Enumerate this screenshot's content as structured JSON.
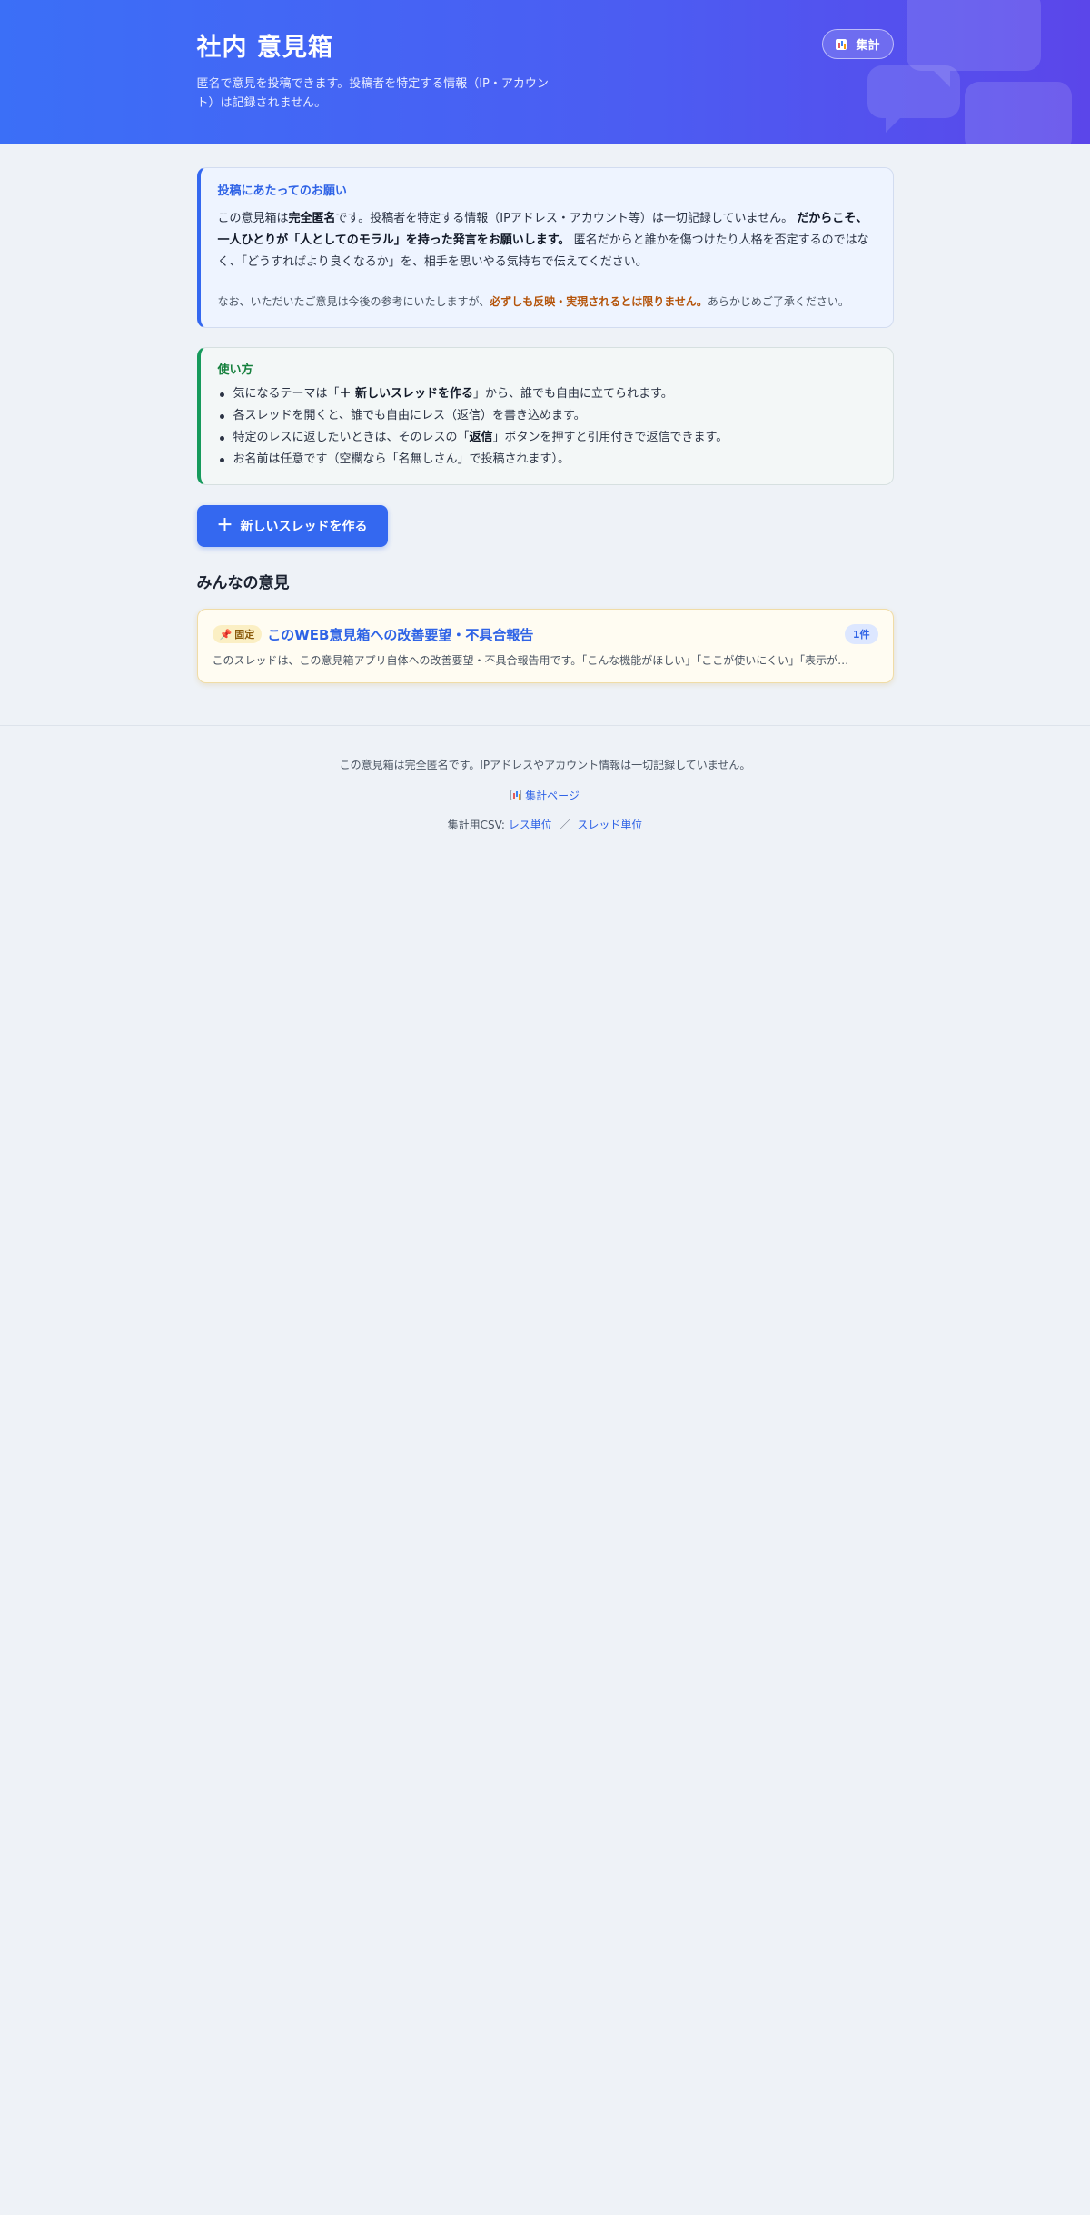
{
  "header": {
    "title": "社内 意見箱",
    "subtitle": "匿名で意見を投稿できます。投稿者を特定する情報（IP・アカウント）は記録されません。",
    "stats_button": "集計"
  },
  "notice": {
    "title": "投稿にあたってのお願い",
    "p1_a": "この意見箱は",
    "p1_b": "完全匿名",
    "p1_c": "です。投稿者を特定する情報（IPアドレス・アカウント等）は一切記録していません。",
    "p1_d": "だからこそ、一人ひとりが「人としてのモラル」を持った発言をお願いします。",
    "p1_e": "匿名だからと誰かを傷つけたり人格を否定するのではなく、「どうすればより良くなるか」を、相手を思いやる気持ちで伝えてください。",
    "foot_a": "なお、いただいたご意見は今後の参考にいたしますが、",
    "foot_b": "必ずしも反映・実現されるとは限りません。",
    "foot_c": "あらかじめご了承ください。"
  },
  "howto": {
    "title": "使い方",
    "item1_a": "気になるテーマは「",
    "item1_b": "＋ 新しいスレッドを作る",
    "item1_c": "」から、誰でも自由に立てられます。",
    "item2": "各スレッドを開くと、誰でも自由にレス（返信）を書き込めます。",
    "item3_a": "特定のレスに返したいときは、そのレスの「",
    "item3_b": "返信",
    "item3_c": "」ボタンを押すと引用付きで返信できます。",
    "item4": "お名前は任意です（空欄なら「名無しさん」で投稿されます）。"
  },
  "new_thread_button": "新しいスレッドを作る",
  "section_title": "みんなの意見",
  "threads": [
    {
      "pinned_label": "固定",
      "title": "このWEB意見箱への改善要望・不具合報告",
      "count": "1件",
      "excerpt": "このスレッドは、この意見箱アプリ自体への改善要望・不具合報告用です。「こんな機能がほしい」「ここが使いにくい」「表示が…"
    }
  ],
  "footer": {
    "note": "この意見箱は完全匿名です。IPアドレスやアカウント情報は一切記録していません。",
    "stats_link": "集計ページ",
    "csv_label": "集計用CSV:",
    "csv_res": "レス単位",
    "csv_sep": "／",
    "csv_thread": "スレッド単位"
  },
  "colors": {
    "primary": "#3468f0",
    "notice_accent": "#3468f0",
    "howto_accent": "#169a5c",
    "warning": "#b45309"
  }
}
